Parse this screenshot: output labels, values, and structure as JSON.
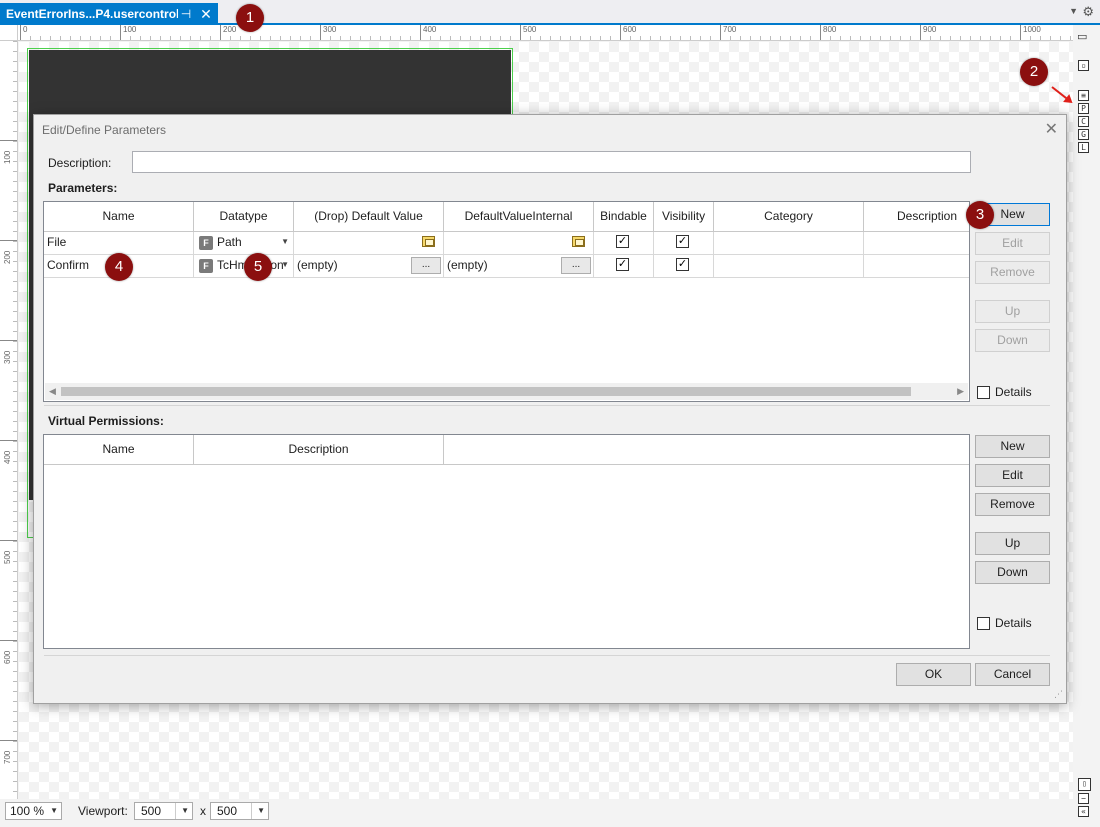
{
  "tab": {
    "title": "EventErrorIns...P4.usercontrol",
    "pin": "⊣",
    "close": "✕"
  },
  "toolbar": {
    "menu_arrow": "▼",
    "gear": "⚙"
  },
  "ruler": {
    "h_labels": [
      "0",
      "100",
      "200",
      "300",
      "400",
      "500",
      "600",
      "700",
      "800",
      "900",
      "1000"
    ],
    "v_labels": [
      "100",
      "200",
      "300",
      "400",
      "500",
      "600",
      "700"
    ]
  },
  "right_strip": {
    "icons": [
      "page-icon",
      "toggle-icon",
      "properties-icon",
      "p-icon",
      "c-icon",
      "g-icon",
      "l-icon",
      "layout-icon",
      "minimize-icon",
      "collapse-icon"
    ],
    "letters": {
      "p": "P",
      "c": "C",
      "g": "G",
      "l": "L",
      "e": "≡"
    }
  },
  "bottom": {
    "zoom": "100 %",
    "viewport_label": "Viewport:",
    "viewport_w": "500",
    "viewport_x": "x",
    "viewport_h": "500"
  },
  "dialog": {
    "title": "Edit/Define Parameters",
    "close": "✕",
    "description_label": "Description:",
    "description_value": "",
    "parameters_label": "Parameters:",
    "param_columns": [
      "Name",
      "Datatype",
      "(Drop) Default Value",
      "DefaultValueInternal",
      "Bindable",
      "Visibility",
      "Category",
      "Description"
    ],
    "param_rows": [
      {
        "name": "File",
        "datatype": "Path",
        "default": "",
        "internal": "",
        "bindable": true,
        "visibility": true,
        "category": "",
        "description": ""
      },
      {
        "name": "Confirm",
        "datatype": "TcHmiAction",
        "default": "(empty)",
        "internal": "(empty)",
        "bindable": true,
        "visibility": true,
        "category": "",
        "description": ""
      }
    ],
    "ftag": "F",
    "ellipsis": "...",
    "param_buttons": {
      "new": "New",
      "edit": "Edit",
      "remove": "Remove",
      "up": "Up",
      "down": "Down"
    },
    "details_label": "Details",
    "virtual_label": "Virtual Permissions:",
    "virt_columns": [
      "Name",
      "Description"
    ],
    "virt_buttons": {
      "new": "New",
      "edit": "Edit",
      "remove": "Remove",
      "up": "Up",
      "down": "Down"
    },
    "virt_details_label": "Details",
    "ok": "OK",
    "cancel": "Cancel"
  },
  "badges": [
    "1",
    "2",
    "3",
    "4",
    "5"
  ],
  "colors": {
    "accent": "#007acc",
    "badge": "#8b0f0f",
    "arrow": "#e0201a",
    "selection_green": "#4cd04c"
  }
}
